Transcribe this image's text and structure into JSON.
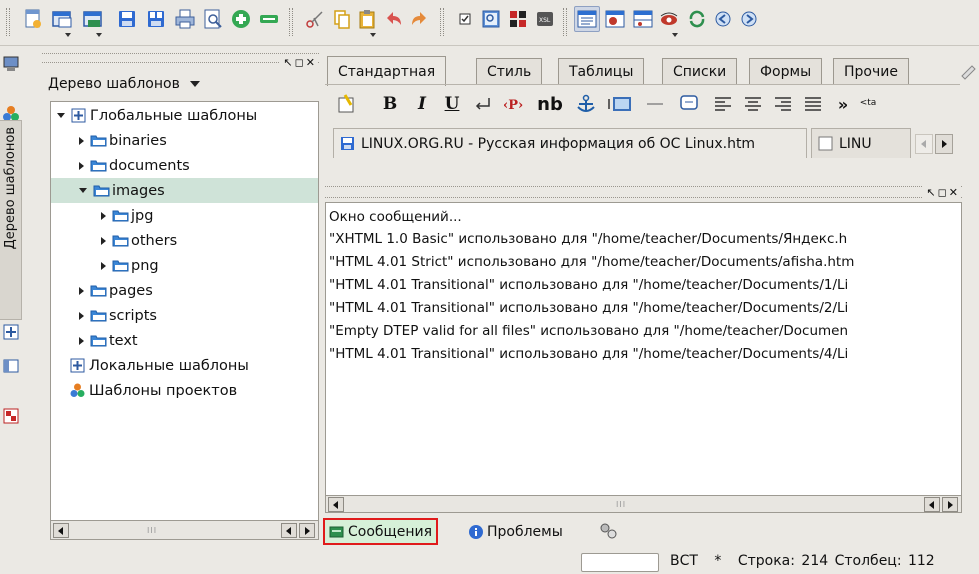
{
  "tree_panel": {
    "title": "Дерево шаблонов",
    "vertical_tab_label": "Дерево шаблонов",
    "items": [
      {
        "label": "Глобальные шаблоны",
        "kind": "template-root",
        "expanded": true
      },
      {
        "label": "binaries",
        "kind": "folder",
        "expanded": false
      },
      {
        "label": "documents",
        "kind": "folder",
        "expanded": false
      },
      {
        "label": "images",
        "kind": "folder",
        "expanded": true,
        "selected": true
      },
      {
        "label": "jpg",
        "kind": "folder",
        "expanded": false
      },
      {
        "label": "others",
        "kind": "folder",
        "expanded": false
      },
      {
        "label": "png",
        "kind": "folder",
        "expanded": false
      },
      {
        "label": "pages",
        "kind": "folder",
        "expanded": false
      },
      {
        "label": "scripts",
        "kind": "folder",
        "expanded": false
      },
      {
        "label": "text",
        "kind": "folder",
        "expanded": false
      },
      {
        "label": "Локальные шаблоны",
        "kind": "template-root"
      },
      {
        "label": "Шаблоны проектов",
        "kind": "project-root"
      }
    ],
    "scroll_grip": "III"
  },
  "quickbar": {
    "tabs": [
      "Стандартная",
      "Стиль",
      "Таблицы",
      "Списки",
      "Формы",
      "Прочие"
    ],
    "active_tab": "Стандартная",
    "format_buttons": [
      "B",
      "I",
      "U",
      "nb",
      "»"
    ],
    "tag_hint": "<ta"
  },
  "documents": {
    "tabs": [
      {
        "label": "LINUX.ORG.RU - Русская информация об ОС Linux.htm"
      },
      {
        "label": "LINU"
      }
    ]
  },
  "messages": {
    "lines": [
      "Окно сообщений...",
      "\"XHTML 1.0 Basic\" использовано для \"/home/teacher/Documents/Яндекс.h",
      "\"HTML 4.01 Strict\" использовано для \"/home/teacher/Documents/afisha.htm",
      "\"HTML 4.01 Transitional\" использовано для \"/home/teacher/Documents/1/Li",
      "\"HTML 4.01 Transitional\" использовано для \"/home/teacher/Documents/2/Li",
      "\"Empty DTEP valid for all files\" использовано для \"/home/teacher/Documen",
      "\"HTML 4.01 Transitional\" использовано для \"/home/teacher/Documents/4/Li"
    ],
    "scroll_grip": "III"
  },
  "bottom_tabs": {
    "messages": "Сообщения",
    "problems": "Проблемы"
  },
  "statusbar": {
    "mode": "ВСТ",
    "modified": "*",
    "line": "Строка: 214",
    "column": "Столбец: 112"
  },
  "icons": {
    "toolbar": [
      "new-file-icon",
      "new-window-icon",
      "open-icon",
      "save-icon",
      "save-all-icon",
      "print-icon",
      "preview-icon",
      "add-icon",
      "remove-icon",
      "cut-icon",
      "copy-icon",
      "paste-icon",
      "undo-icon",
      "redo-icon",
      "checkbox-icon",
      "image-view-icon",
      "plugin-icon",
      "xsl-icon",
      "source-view-icon",
      "vpl-view-icon",
      "split-view-icon",
      "eye-preview-icon",
      "reload-icon",
      "back-icon",
      "forward-icon"
    ]
  }
}
